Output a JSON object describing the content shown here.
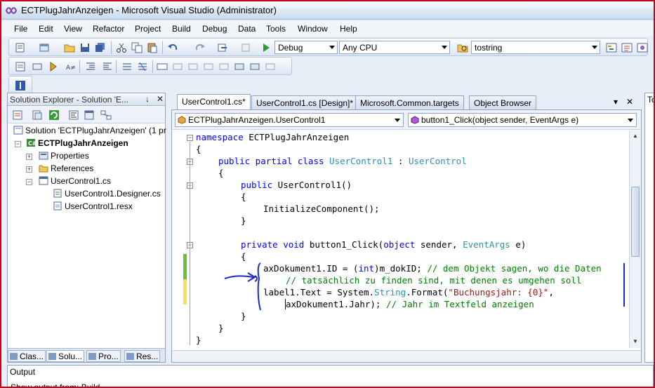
{
  "window": {
    "title": "ECTPlugJahrAnzeigen - Microsoft Visual Studio (Administrator)"
  },
  "menu": [
    "File",
    "Edit",
    "View",
    "Refactor",
    "Project",
    "Build",
    "Debug",
    "Data",
    "Tools",
    "Window",
    "Help"
  ],
  "toolbar": {
    "configuration": "Debug",
    "platform": "Any CPU",
    "find_text": "tostring"
  },
  "solution_explorer": {
    "title": "Solution Explorer - Solution 'E...",
    "pin": "↓",
    "close": "✕",
    "tree": {
      "solution": "Solution 'ECTPlugJahrAnzeigen' (1 pr",
      "project": "ECTPlugJahrAnzeigen",
      "properties": "Properties",
      "references": "References",
      "file": "UserControl1.cs",
      "designer": "UserControl1.Designer.cs",
      "resx": "UserControl1.resx"
    },
    "bottom_tabs": [
      "Clas...",
      "Solu...",
      "Pro...",
      "Res..."
    ]
  },
  "document_tabs": [
    "UserControl1.cs*",
    "UserControl1.cs [Design]*",
    "Microsoft.Common.targets",
    "Object Browser"
  ],
  "document_tab_menu": "▾",
  "document_tab_close": "✕",
  "nav": {
    "type_combo": "ECTPlugJahrAnzeigen.UserControl1",
    "member_combo": "button1_Click(object sender, EventArgs e)"
  },
  "code": {
    "l1_kw": "namespace",
    "l1_rest": " ECTPlugJahrAnzeigen",
    "l2": "{",
    "l3_kw": "public partial class",
    "l3_ty1": "UserControl1",
    "l3_mid": " : ",
    "l3_ty2": "UserControl",
    "l4": "{",
    "l5_kw": "public",
    "l5_rest": " UserControl1()",
    "l6": "{",
    "l7": "InitializeComponent();",
    "l8": "}",
    "l9_kw": "private void",
    "l9_a": " button1_Click(",
    "l9_kw2": "object",
    "l9_b": " sender, ",
    "l9_ty": "EventArgs",
    "l9_c": " e)",
    "l10": "{",
    "l11_a": "axDokument1.ID = (",
    "l11_kw": "int",
    "l11_b": ")m_dokID; ",
    "l11_cm": "// dem Objekt sagen, wo die Daten",
    "l12_cm": "// tatsächlich zu finden sind, mit denen es umgehen soll",
    "l13_a": "label1.Text = System.",
    "l13_ty": "String",
    "l13_b": ".Format(",
    "l13_st": "\"Buchungsjahr: {0}\"",
    "l13_c": ",",
    "l14_a": "axDokument1.Jahr); ",
    "l14_cm": "// Jahr im Textfeld anzeigen",
    "l15": "}",
    "l16": "}",
    "l17": "}"
  },
  "right_panel": {
    "title": "To"
  },
  "output": {
    "title": "Output",
    "show_from_label": "Show output from:",
    "show_from_value": "Build"
  }
}
